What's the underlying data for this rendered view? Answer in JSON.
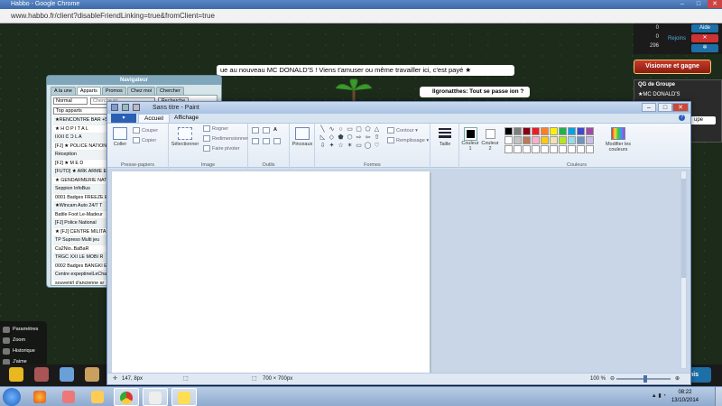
{
  "chrome": {
    "title": "Habbo - Google Chrome",
    "url": "www.habbo.fr/client?disableFriendLinking=true&fromClient=true"
  },
  "habbo": {
    "announcement": "ue au nouveau MC DONALD'S ! Viens t'amuser ou même travailler ici, c'est payé ★",
    "chat_bubble": "Ilgronatthes: Tout se passe ion ?",
    "hud": {
      "diamonds": "0",
      "credits": "0",
      "duckets": "296",
      "aide": "Aide",
      "rejoins": "Rejoins"
    },
    "visionne_button": "Visionne et gagne",
    "group_panel": {
      "title": "QG de Groupe",
      "group_name": "★MC DONALD'S",
      "button": "upe"
    },
    "navigator": {
      "title": "Navigateur",
      "tabs": [
        "A la une",
        "Apparts",
        "Promos",
        "Chez moi",
        "Chercher"
      ],
      "active_tab": 1,
      "filter_value": "Normal",
      "search_placeholder": "Cherche ici..",
      "search_button": "Recherche",
      "category": "Top apparts",
      "rooms": [
        "★RENCONTRE BAR +50",
        "★ H O P I T A L",
        "IXXI Ͼ Ɔ L A",
        "[FJ] ★ POLICE NATIONA",
        "Réception",
        "[FJ] ★ M E D",
        "[FUTO] ★ ARK ARME EL",
        "★ GENDARMERIE NATION",
        "Seppion InfoBus",
        "0001 Badges FREEZE E",
        "★Wincam Auto 24/7 T",
        "Battle Foot Le-Madeur",
        "[FJ] Police National",
        "★ [FJ] CENTRE MILITA",
        "TP Supreso Multi jeu",
        "Ca2Nio..BaBaR",
        "TRGC XXI LE MOBI R",
        "0002 Badges BANGKI E",
        "Centre expeptinelLeCha",
        "souvenirl d'ancienne ar",
        "Appart de lattreveurl"
      ]
    },
    "left_menu": [
      "Paramètres",
      "Zoom",
      "Historique",
      "J'aime"
    ],
    "amis_button": "mis"
  },
  "paint": {
    "title": "Sans titre - Paint",
    "tabs": [
      "Accueil",
      "Affichage"
    ],
    "ribbon": {
      "clipboard": {
        "label": "Presse-papiers",
        "coller": "Coller",
        "couper": "Couper",
        "copier": "Copier"
      },
      "image": {
        "label": "Image",
        "select": "Sélectionner",
        "rogner": "Rogner",
        "redim": "Redimensionner",
        "pivoter": "Faire pivoter"
      },
      "outils": {
        "label": "Outils"
      },
      "pinceaux": "Pinceaux",
      "formes": {
        "label": "Formes",
        "contour": "Contour",
        "remplissage": "Remplissage"
      },
      "taille": "Taille",
      "couleur1": "Couleur 1",
      "couleur2": "Couleur 2",
      "couleurs": {
        "label": "Couleurs",
        "modifier": "Modifier les couleurs"
      }
    },
    "palette": [
      "#000000",
      "#7f7f7f",
      "#880015",
      "#ed1c24",
      "#ff7f27",
      "#fff200",
      "#22b14c",
      "#00a2e8",
      "#3f48cc",
      "#a349a4",
      "#ffffff",
      "#c3c3c3",
      "#b97a57",
      "#ffaec9",
      "#ffc90e",
      "#efe4b0",
      "#b5e61d",
      "#99d9ea",
      "#7092be",
      "#c8bfe7",
      "#ffffff",
      "#ffffff",
      "#ffffff",
      "#ffffff",
      "#ffffff",
      "#ffffff",
      "#ffffff",
      "#ffffff",
      "#ffffff",
      "#ffffff"
    ],
    "status": {
      "cursor": "147, 8px",
      "size": "700 × 700px",
      "zoom": "100 %"
    }
  },
  "taskbar": {
    "time": "08:22",
    "date": "13/10/2014"
  }
}
